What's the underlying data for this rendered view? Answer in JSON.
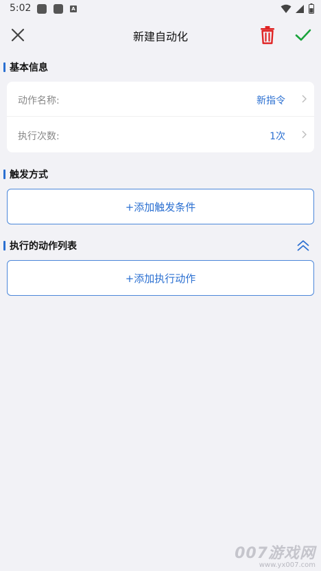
{
  "status_bar": {
    "time": "5:02",
    "app_icon_letter": "A",
    "icons": [
      "app-icon",
      "app-icon",
      "a-icon",
      "wifi-icon",
      "signal-icon",
      "battery-icon"
    ]
  },
  "header": {
    "title": "新建自动化",
    "close_icon": "close-icon",
    "delete_icon": "trash-icon",
    "confirm_icon": "check-icon",
    "colors": {
      "delete": "#e02424",
      "confirm": "#19a33b"
    }
  },
  "basic_info": {
    "title": "基本信息",
    "rows": [
      {
        "label": "动作名称:",
        "value": "新指令"
      },
      {
        "label": "执行次数:",
        "value": "1次"
      }
    ]
  },
  "trigger": {
    "title": "触发方式",
    "add_label": "+添加触发条件"
  },
  "actions": {
    "title": "执行的动作列表",
    "collapse_icon": "chevron-double-up-icon",
    "add_label": "+添加执行动作"
  },
  "watermark": {
    "main": "007游戏网",
    "sub": "www.yx007.com"
  },
  "colors": {
    "accent": "#2a6fd1",
    "background": "#f2f2f6"
  }
}
